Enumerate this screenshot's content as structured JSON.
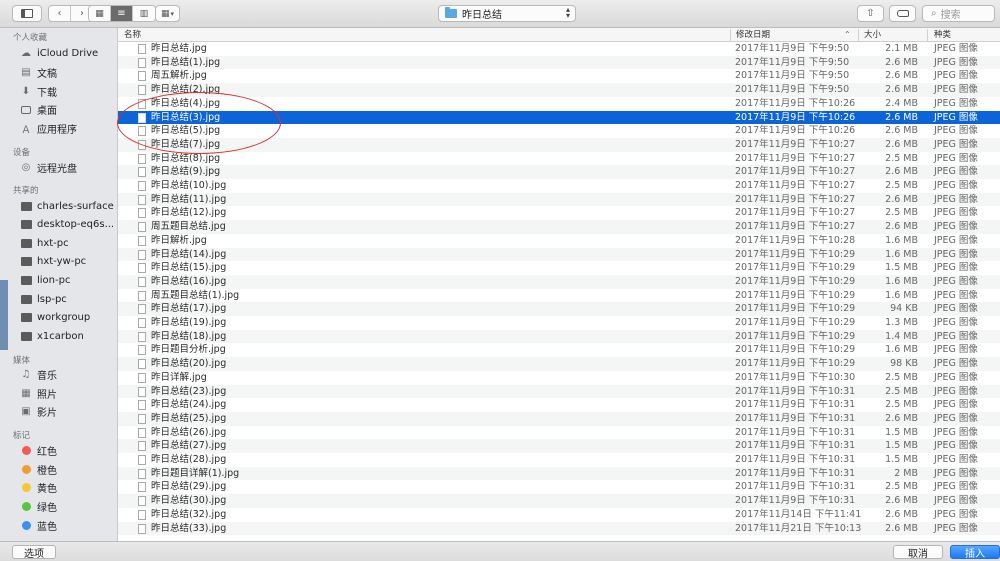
{
  "toolbar": {
    "path_title": "昨日总结",
    "search_placeholder": "搜索"
  },
  "sidebar": {
    "sections": [
      {
        "header": "个人收藏",
        "items": [
          {
            "label": "iCloud Drive",
            "icon": "cloud-icon"
          },
          {
            "label": "文稿",
            "icon": "document-icon"
          },
          {
            "label": "下载",
            "icon": "download-icon"
          },
          {
            "label": "桌面",
            "icon": "desktop-icon"
          },
          {
            "label": "应用程序",
            "icon": "applications-icon"
          }
        ]
      },
      {
        "header": "设备",
        "items": [
          {
            "label": "远程光盘",
            "icon": "disc-icon"
          }
        ]
      },
      {
        "header": "共享的",
        "items": [
          {
            "label": "charles-surface",
            "icon": "computer-icon"
          },
          {
            "label": "desktop-eq6s...",
            "icon": "computer-icon"
          },
          {
            "label": "hxt-pc",
            "icon": "computer-icon"
          },
          {
            "label": "hxt-yw-pc",
            "icon": "computer-icon"
          },
          {
            "label": "lion-pc",
            "icon": "computer-icon"
          },
          {
            "label": "lsp-pc",
            "icon": "computer-icon"
          },
          {
            "label": "workgroup",
            "icon": "computer-icon"
          },
          {
            "label": "x1carbon",
            "icon": "computer-icon"
          }
        ]
      },
      {
        "header": "媒体",
        "items": [
          {
            "label": "音乐",
            "icon": "music-icon"
          },
          {
            "label": "照片",
            "icon": "photos-icon"
          },
          {
            "label": "影片",
            "icon": "movies-icon"
          }
        ]
      },
      {
        "header": "标记",
        "items": [
          {
            "label": "红色",
            "color": "#f25a52"
          },
          {
            "label": "橙色",
            "color": "#f59a32"
          },
          {
            "label": "黄色",
            "color": "#f5c832"
          },
          {
            "label": "绿色",
            "color": "#5ac43c"
          },
          {
            "label": "蓝色",
            "color": "#3a8ff0"
          }
        ]
      }
    ]
  },
  "columns": {
    "name": "名称",
    "date": "修改日期",
    "size": "大小",
    "kind": "种类"
  },
  "files": [
    {
      "name": "昨日总结.jpg",
      "date": "2017年11月9日 下午9:50",
      "size": "2.1 MB",
      "kind": "JPEG 图像"
    },
    {
      "name": "昨日总结(1).jpg",
      "date": "2017年11月9日 下午9:50",
      "size": "2.6 MB",
      "kind": "JPEG 图像"
    },
    {
      "name": "周五解析.jpg",
      "date": "2017年11月9日 下午9:50",
      "size": "2.6 MB",
      "kind": "JPEG 图像"
    },
    {
      "name": "昨日总结(2).jpg",
      "date": "2017年11月9日 下午9:50",
      "size": "2.6 MB",
      "kind": "JPEG 图像"
    },
    {
      "name": "昨日总结(4).jpg",
      "date": "2017年11月9日 下午10:26",
      "size": "2.4 MB",
      "kind": "JPEG 图像"
    },
    {
      "name": "昨日总结(3).jpg",
      "date": "2017年11月9日 下午10:26",
      "size": "2.6 MB",
      "kind": "JPEG 图像",
      "selected": true
    },
    {
      "name": "昨日总结(5).jpg",
      "date": "2017年11月9日 下午10:26",
      "size": "2.6 MB",
      "kind": "JPEG 图像"
    },
    {
      "name": "昨日总结(7).jpg",
      "date": "2017年11月9日 下午10:27",
      "size": "2.6 MB",
      "kind": "JPEG 图像"
    },
    {
      "name": "昨日总结(8).jpg",
      "date": "2017年11月9日 下午10:27",
      "size": "2.5 MB",
      "kind": "JPEG 图像"
    },
    {
      "name": "昨日总结(9).jpg",
      "date": "2017年11月9日 下午10:27",
      "size": "2.6 MB",
      "kind": "JPEG 图像"
    },
    {
      "name": "昨日总结(10).jpg",
      "date": "2017年11月9日 下午10:27",
      "size": "2.5 MB",
      "kind": "JPEG 图像"
    },
    {
      "name": "昨日总结(11).jpg",
      "date": "2017年11月9日 下午10:27",
      "size": "2.6 MB",
      "kind": "JPEG 图像"
    },
    {
      "name": "昨日总结(12).jpg",
      "date": "2017年11月9日 下午10:27",
      "size": "2.5 MB",
      "kind": "JPEG 图像"
    },
    {
      "name": "周五题目总结.jpg",
      "date": "2017年11月9日 下午10:27",
      "size": "2.6 MB",
      "kind": "JPEG 图像"
    },
    {
      "name": "昨日解析.jpg",
      "date": "2017年11月9日 下午10:28",
      "size": "1.6 MB",
      "kind": "JPEG 图像"
    },
    {
      "name": "昨日总结(14).jpg",
      "date": "2017年11月9日 下午10:29",
      "size": "1.6 MB",
      "kind": "JPEG 图像"
    },
    {
      "name": "昨日总结(15).jpg",
      "date": "2017年11月9日 下午10:29",
      "size": "1.5 MB",
      "kind": "JPEG 图像"
    },
    {
      "name": "昨日总结(16).jpg",
      "date": "2017年11月9日 下午10:29",
      "size": "1.6 MB",
      "kind": "JPEG 图像"
    },
    {
      "name": "周五题目总结(1).jpg",
      "date": "2017年11月9日 下午10:29",
      "size": "1.6 MB",
      "kind": "JPEG 图像"
    },
    {
      "name": "昨日总结(17).jpg",
      "date": "2017年11月9日 下午10:29",
      "size": "94 KB",
      "kind": "JPEG 图像"
    },
    {
      "name": "昨日总结(19).jpg",
      "date": "2017年11月9日 下午10:29",
      "size": "1.3 MB",
      "kind": "JPEG 图像"
    },
    {
      "name": "昨日总结(18).jpg",
      "date": "2017年11月9日 下午10:29",
      "size": "1.4 MB",
      "kind": "JPEG 图像"
    },
    {
      "name": "昨日题目分析.jpg",
      "date": "2017年11月9日 下午10:29",
      "size": "1.6 MB",
      "kind": "JPEG 图像"
    },
    {
      "name": "昨日总结(20).jpg",
      "date": "2017年11月9日 下午10:29",
      "size": "98 KB",
      "kind": "JPEG 图像"
    },
    {
      "name": "昨日详解.jpg",
      "date": "2017年11月9日 下午10:30",
      "size": "2.5 MB",
      "kind": "JPEG 图像"
    },
    {
      "name": "昨日总结(23).jpg",
      "date": "2017年11月9日 下午10:31",
      "size": "2.5 MB",
      "kind": "JPEG 图像"
    },
    {
      "name": "昨日总结(24).jpg",
      "date": "2017年11月9日 下午10:31",
      "size": "2.5 MB",
      "kind": "JPEG 图像"
    },
    {
      "name": "昨日总结(25).jpg",
      "date": "2017年11月9日 下午10:31",
      "size": "2.6 MB",
      "kind": "JPEG 图像"
    },
    {
      "name": "昨日总结(26).jpg",
      "date": "2017年11月9日 下午10:31",
      "size": "1.5 MB",
      "kind": "JPEG 图像"
    },
    {
      "name": "昨日总结(27).jpg",
      "date": "2017年11月9日 下午10:31",
      "size": "1.5 MB",
      "kind": "JPEG 图像"
    },
    {
      "name": "昨日总结(28).jpg",
      "date": "2017年11月9日 下午10:31",
      "size": "1.5 MB",
      "kind": "JPEG 图像"
    },
    {
      "name": "昨日题目详解(1).jpg",
      "date": "2017年11月9日 下午10:31",
      "size": "2 MB",
      "kind": "JPEG 图像"
    },
    {
      "name": "昨日总结(29).jpg",
      "date": "2017年11月9日 下午10:31",
      "size": "2.5 MB",
      "kind": "JPEG 图像"
    },
    {
      "name": "昨日总结(30).jpg",
      "date": "2017年11月9日 下午10:31",
      "size": "2.6 MB",
      "kind": "JPEG 图像"
    },
    {
      "name": "昨日总结(32).jpg",
      "date": "2017年11月14日 下午11:41",
      "size": "2.6 MB",
      "kind": "JPEG 图像"
    },
    {
      "name": "昨日总结(33).jpg",
      "date": "2017年11月21日 下午10:13",
      "size": "2.6 MB",
      "kind": "JPEG 图像"
    }
  ],
  "bottom": {
    "options_label": "选项",
    "cancel_label": "取消",
    "insert_label": "插入"
  },
  "colors": {
    "selection": "#0d64d8",
    "annotation": "#d9302a",
    "primary_button": "#1a7af2"
  }
}
